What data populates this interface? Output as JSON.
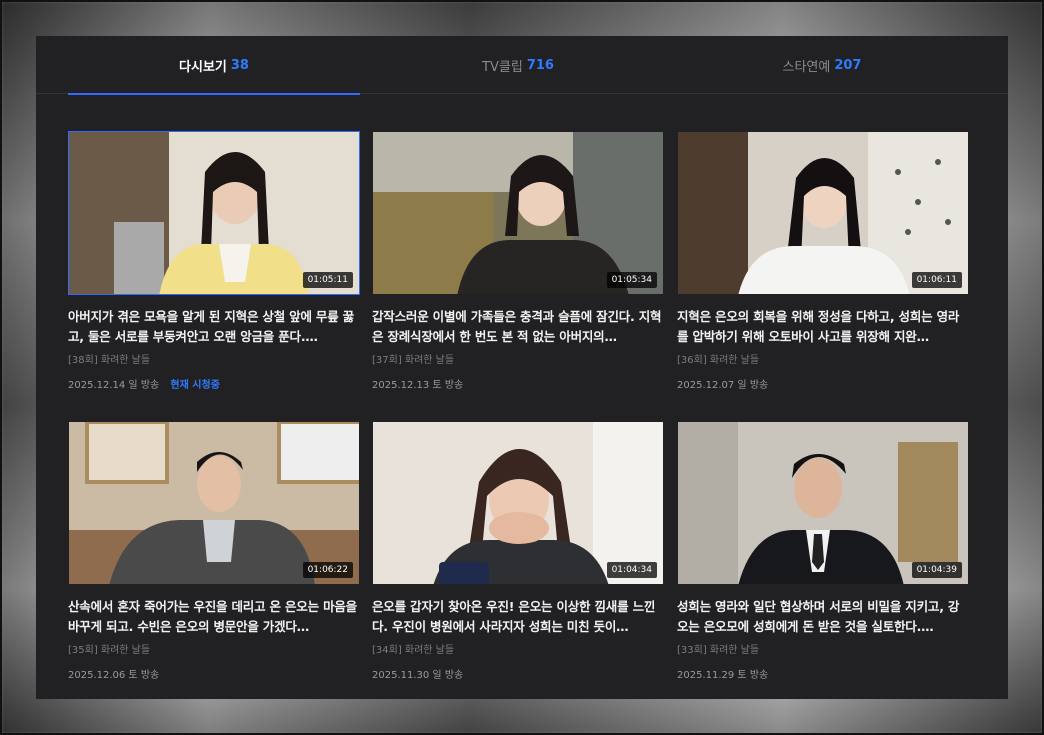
{
  "tabs": [
    {
      "label": "다시보기",
      "count": "38",
      "active": true
    },
    {
      "label": "TV클립",
      "count": "716",
      "active": false
    },
    {
      "label": "스타연예",
      "count": "207",
      "active": false
    }
  ],
  "colors": {
    "accent": "#2f6bff",
    "panel": "#212123"
  },
  "episodes": [
    {
      "duration": "01:05:11",
      "title": "아버지가 겪은 모욕을 알게 된 지혁은 상철 앞에 무릎 꿇고, 둘은 서로를 부둥켜안고 오랜 앙금을 푼다.…",
      "program": "[38회] 화려한 날들",
      "date": "2025.12.14 일 방송",
      "now": "현재 시청중"
    },
    {
      "duration": "01:05:34",
      "title": "갑작스러운 이별에 가족들은 충격과 슬픔에 잠긴다. 지혁은 장례식장에서 한 번도 본 적 없는 아버지의…",
      "program": "[37회] 화려한 날들",
      "date": "2025.12.13 토 방송"
    },
    {
      "duration": "01:06:11",
      "title": "지혁은 은오의 회복을 위해 정성을 다하고, 성희는 영라를 압박하기 위해 오토바이 사고를 위장해 지완…",
      "program": "[36회] 화려한 날들",
      "date": "2025.12.07 일 방송"
    },
    {
      "duration": "01:06:22",
      "title": "산속에서 혼자 죽어가는 우진을 데리고 온 은오는 마음을 바꾸게 되고. 수빈은 은오의 병문안을 가겠다…",
      "program": "[35회] 화려한 날들",
      "date": "2025.12.06 토 방송"
    },
    {
      "duration": "01:04:34",
      "title": "은오를 갑자기 찾아온 우진! 은오는 이상한 낌새를 느낀다. 우진이 병원에서 사라지자 성희는 미친 듯이…",
      "program": "[34회] 화려한 날들",
      "date": "2025.11.30 일 방송"
    },
    {
      "duration": "01:04:39",
      "title": "성희는 영라와 일단 협상하며 서로의 비밀을 지키고, 강오는 은오모에 성희에게 돈 받은 것을 실토한다.…",
      "program": "[33회] 화려한 날들",
      "date": "2025.11.29 토 방송"
    }
  ]
}
